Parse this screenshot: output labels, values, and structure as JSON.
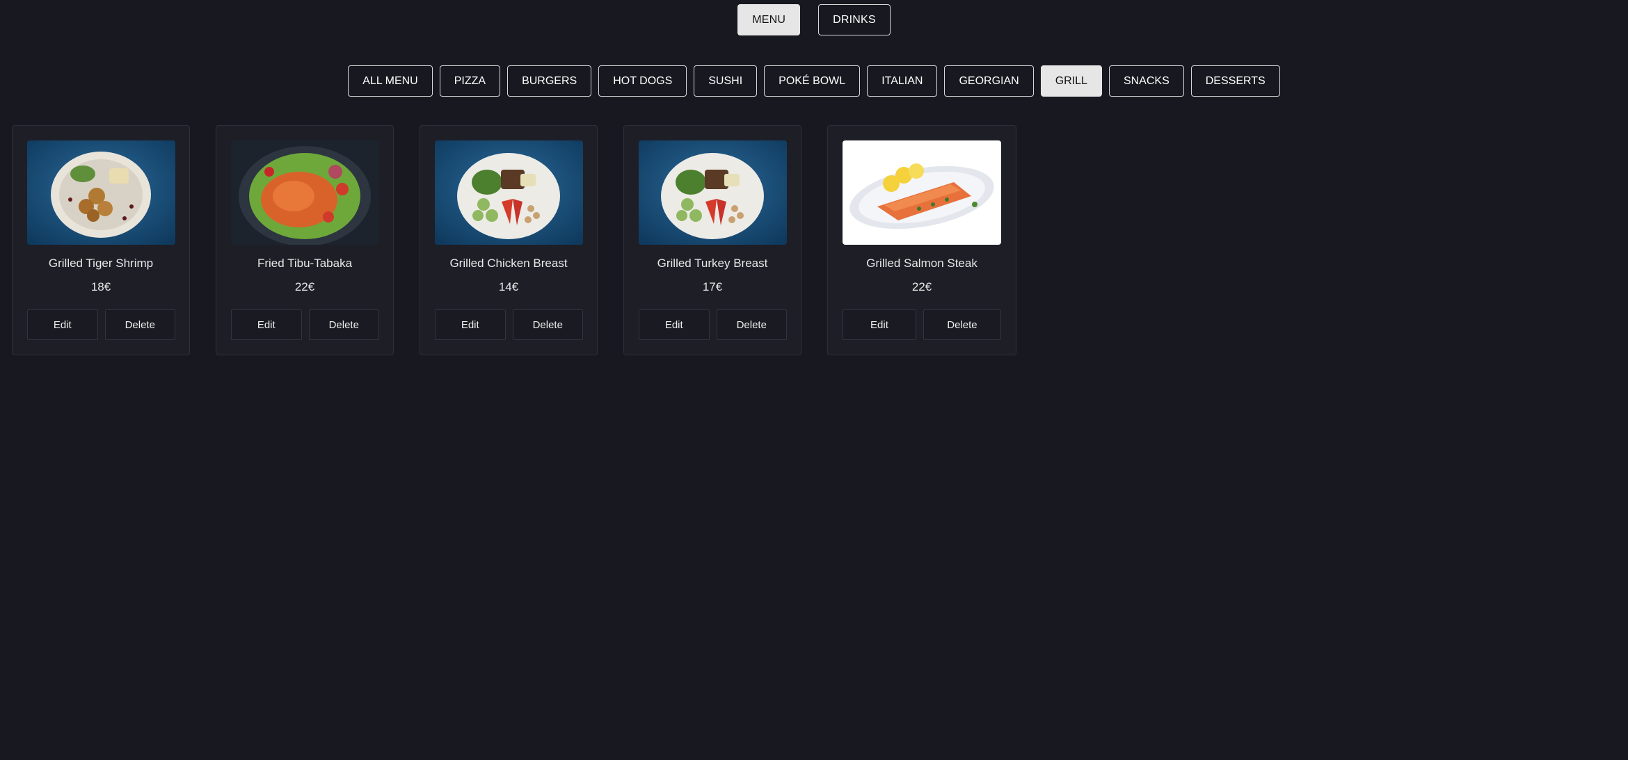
{
  "top_nav": [
    {
      "label": "MENU",
      "active": true
    },
    {
      "label": "DRINKS",
      "active": false
    }
  ],
  "categories": [
    {
      "label": "ALL MENU",
      "active": false
    },
    {
      "label": "PIZZA",
      "active": false
    },
    {
      "label": "BURGERS",
      "active": false
    },
    {
      "label": "HOT DOGS",
      "active": false
    },
    {
      "label": "SUSHI",
      "active": false
    },
    {
      "label": "POKÉ BOWL",
      "active": false
    },
    {
      "label": "ITALIAN",
      "active": false
    },
    {
      "label": "GEORGIAN",
      "active": false
    },
    {
      "label": "GRILL",
      "active": true
    },
    {
      "label": "SNACKS",
      "active": false
    },
    {
      "label": "DESSERTS",
      "active": false
    }
  ],
  "items": [
    {
      "name": "Grilled Tiger Shrimp",
      "price": "18€",
      "edit_label": "Edit",
      "delete_label": "Delete",
      "image": "grilled-shrimp-plate"
    },
    {
      "name": "Fried Tibu-Tabaka",
      "price": "22€",
      "edit_label": "Edit",
      "delete_label": "Delete",
      "image": "fried-chicken-plate"
    },
    {
      "name": "Grilled Chicken Breast",
      "price": "14€",
      "edit_label": "Edit",
      "delete_label": "Delete",
      "image": "grilled-chicken-plate"
    },
    {
      "name": "Grilled Turkey Breast",
      "price": "17€",
      "edit_label": "Edit",
      "delete_label": "Delete",
      "image": "grilled-turkey-plate"
    },
    {
      "name": "Grilled Salmon Steak",
      "price": "22€",
      "edit_label": "Edit",
      "delete_label": "Delete",
      "image": "salmon-steak-plate"
    }
  ],
  "colors": {
    "background": "#181820",
    "card": "#1e1e27",
    "active_button": "#e6e6e6",
    "border": "#d8d8d8"
  }
}
